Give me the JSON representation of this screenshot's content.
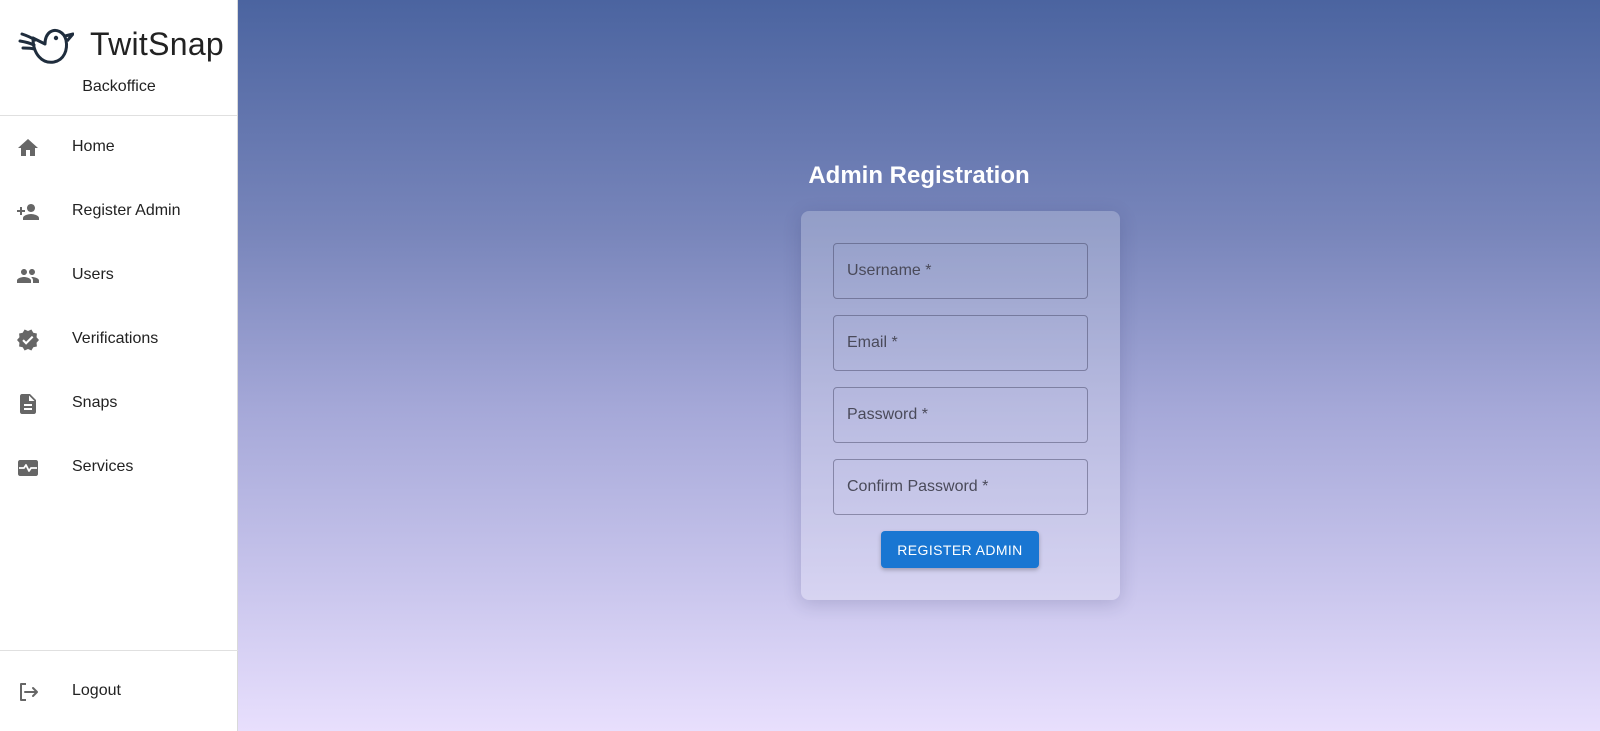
{
  "brand": {
    "name": "TwitSnap",
    "subtitle": "Backoffice",
    "logo_icon": "bird-icon"
  },
  "sidebar": {
    "items": [
      {
        "label": "Home",
        "icon": "home-icon"
      },
      {
        "label": "Register Admin",
        "icon": "person-add-icon"
      },
      {
        "label": "Users",
        "icon": "people-icon"
      },
      {
        "label": "Verifications",
        "icon": "verified-icon"
      },
      {
        "label": "Snaps",
        "icon": "document-icon"
      },
      {
        "label": "Services",
        "icon": "monitor-heart-icon"
      }
    ],
    "logout": {
      "label": "Logout",
      "icon": "logout-icon"
    }
  },
  "form": {
    "title": "Admin Registration",
    "username_placeholder": "Username *",
    "email_placeholder": "Email *",
    "password_placeholder": "Password *",
    "confirm_placeholder": "Confirm Password *",
    "submit_label": "REGISTER ADMIN"
  },
  "colors": {
    "accent": "#1976d2",
    "gradient_top": "#4b64a0",
    "gradient_bottom": "#e8dffd",
    "icon": "#666666"
  }
}
